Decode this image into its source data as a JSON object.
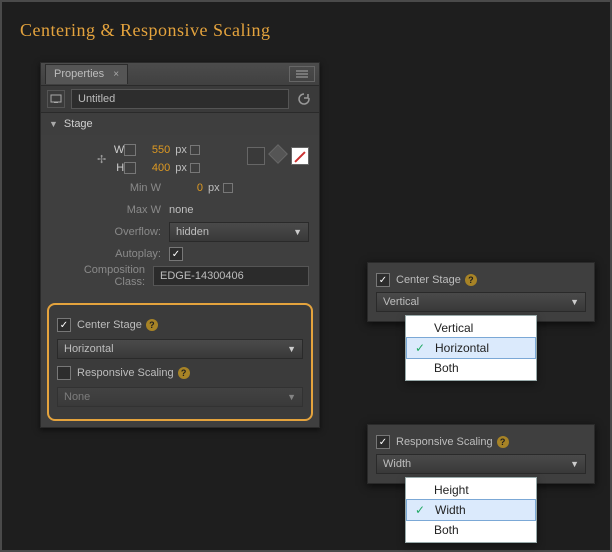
{
  "page_title": "Centering & Responsive Scaling",
  "properties_panel": {
    "tab_label": "Properties",
    "document_name": "Untitled",
    "section_title": "Stage",
    "w_letter": "W",
    "h_letter": "H",
    "w_value": "550",
    "h_value": "400",
    "px_unit": "px",
    "minw_label": "Min W",
    "minw_value": "0",
    "maxw_label": "Max W",
    "maxw_value": "none",
    "overflow_label": "Overflow:",
    "overflow_value": "hidden",
    "autoplay_label": "Autoplay:",
    "autoplay_checked": true,
    "compclass_label": "Composition Class:",
    "compclass_value": "EDGE-14300406",
    "center_stage_label": "Center Stage",
    "center_stage_checked": true,
    "center_stage_value": "Horizontal",
    "responsive_label": "Responsive Scaling",
    "responsive_checked": false,
    "responsive_value": "None"
  },
  "center_popout": {
    "label": "Center Stage",
    "checked": true,
    "value": "Vertical",
    "options": [
      "Vertical",
      "Horizontal",
      "Both"
    ],
    "selected_index": 1
  },
  "responsive_popout": {
    "label": "Responsive Scaling",
    "checked": true,
    "value": "Width",
    "options": [
      "Height",
      "Width",
      "Both"
    ],
    "selected_index": 1
  }
}
